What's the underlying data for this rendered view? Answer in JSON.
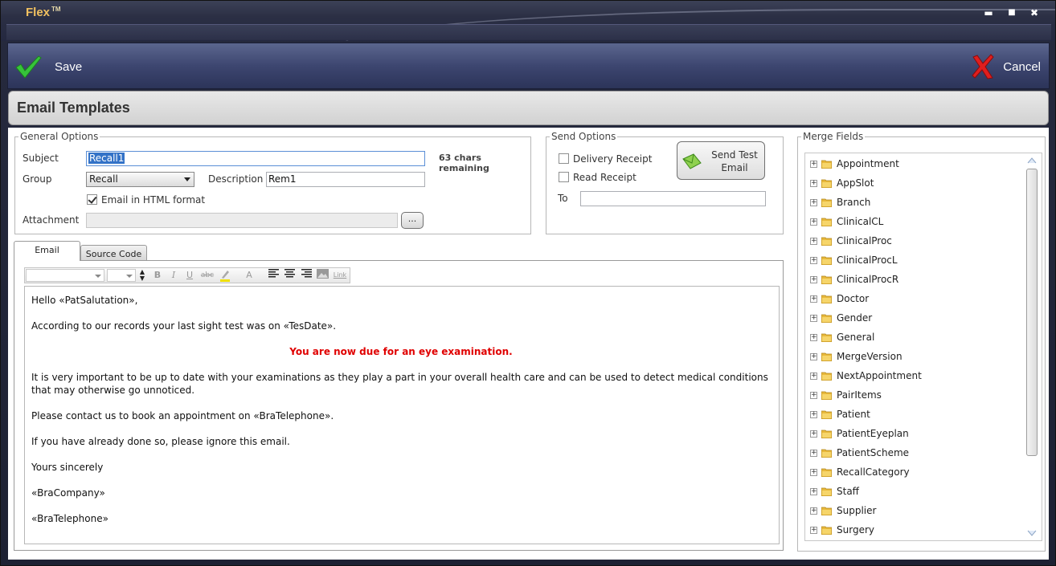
{
  "window": {
    "app_name": "Flex",
    "trademark": "TM",
    "minimize": "▬",
    "maximize": "■",
    "close": "✖"
  },
  "toolbar": {
    "save_label": "Save",
    "cancel_label": "Cancel"
  },
  "page": {
    "title": "Email Templates"
  },
  "general_options": {
    "legend": "General Options",
    "subject_label": "Subject",
    "subject_value": "Recall1",
    "chars_remaining": "63 chars remaining",
    "group_label": "Group",
    "group_value": "Recall",
    "description_label": "Description",
    "description_value": "Rem1",
    "html_format_label": "Email in HTML format",
    "html_format_checked": true,
    "attachment_label": "Attachment",
    "attachment_value": "",
    "browse_label": "..."
  },
  "send_options": {
    "legend": "Send Options",
    "delivery_receipt_label": "Delivery Receipt",
    "read_receipt_label": "Read Receipt",
    "send_test_label_1": "Send Test",
    "send_test_label_2": "Email",
    "to_label": "To",
    "to_value": ""
  },
  "tabs": [
    {
      "label": "Email",
      "active": true
    },
    {
      "label": "Source Code",
      "active": false
    }
  ],
  "formatting": {
    "bold": "B",
    "italic": "I",
    "underline": "U",
    "strike": "abc",
    "font_color": "A",
    "link": "Link"
  },
  "email_body": [
    "Hello «PatSalutation»,",
    "According to our records your last sight test was on «TesDate».",
    "You are now due for an eye examination.",
    "It is very important to be up to date with your examinations as they play a part in your overall health care and can be used to detect medical conditions",
    "that may otherwise go unnoticed.",
    "Please contact us to book an appointment on «BraTelephone».",
    "If you have already done so, please ignore this email.",
    "Yours sincerely",
    "«BraCompany»",
    "«BraTelephone»"
  ],
  "merge_fields": {
    "legend": "Merge Fields",
    "items": [
      "Appointment",
      "AppSlot",
      "Branch",
      "ClinicalCL",
      "ClinicalProc",
      "ClinicalProcL",
      "ClinicalProcR",
      "Doctor",
      "Gender",
      "General",
      "MergeVersion",
      "NextAppointment",
      "PairItems",
      "Patient",
      "PatientEyeplan",
      "PatientScheme",
      "RecallCategory",
      "Staff",
      "Supplier",
      "Surgery"
    ]
  },
  "colors": {
    "accent_red": "#e00000",
    "toolbar_bg": "#3d4670",
    "title_gold": "#f0c060"
  }
}
